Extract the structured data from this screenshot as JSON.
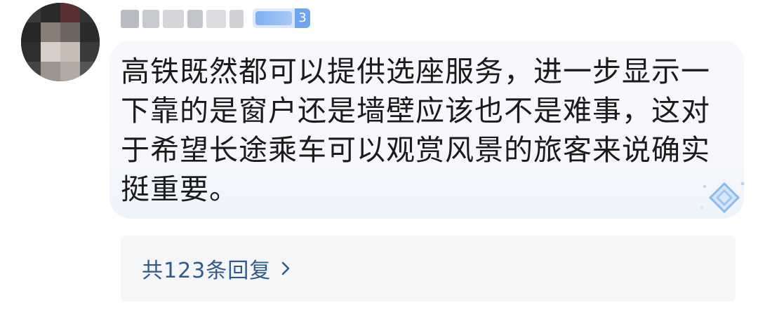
{
  "user": {
    "level": "3"
  },
  "comment": {
    "text": "高铁既然都可以提供选座服务，进一步显示一下靠的是窗户还是墙壁应该也不是难事，这对于希望长途乘车可以观赏风景的旅客来说确实挺重要。"
  },
  "replies": {
    "label": "共123条回复"
  },
  "icons": {
    "avatar": "avatar-icon",
    "level": "level-badge",
    "decoration": "diamond-icon",
    "more": "chevron-right-icon"
  },
  "colors": {
    "reply_link": "#2e5a8e",
    "bubble_bg": "#f5f7fb",
    "badge_bg": "#6fa4ee"
  }
}
